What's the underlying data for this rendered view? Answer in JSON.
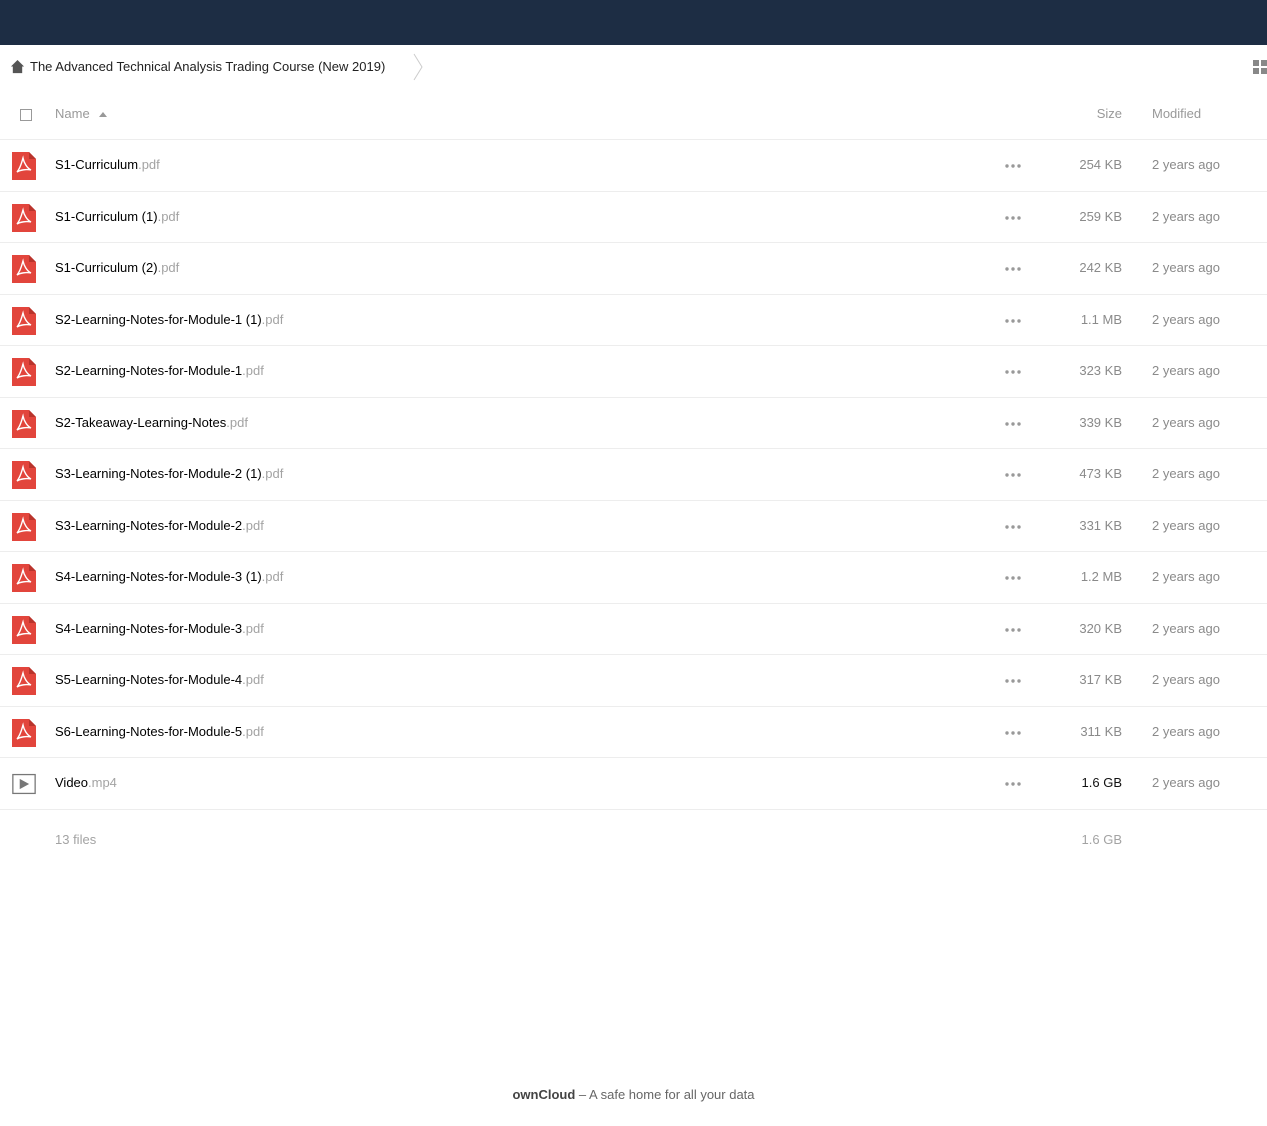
{
  "breadcrumb": {
    "folder": "The Advanced Technical Analysis Trading Course (New 2019)"
  },
  "table": {
    "headers": {
      "name": "Name",
      "size": "Size",
      "modified": "Modified"
    },
    "files": [
      {
        "base": "S1-Curriculum",
        "ext": ".pdf",
        "type": "pdf",
        "size": "254 KB",
        "modified": "2 years ago"
      },
      {
        "base": "S1-Curriculum (1)",
        "ext": ".pdf",
        "type": "pdf",
        "size": "259 KB",
        "modified": "2 years ago"
      },
      {
        "base": "S1-Curriculum (2)",
        "ext": ".pdf",
        "type": "pdf",
        "size": "242 KB",
        "modified": "2 years ago"
      },
      {
        "base": "S2-Learning-Notes-for-Module-1 (1)",
        "ext": ".pdf",
        "type": "pdf",
        "size": "1.1 MB",
        "modified": "2 years ago"
      },
      {
        "base": "S2-Learning-Notes-for-Module-1",
        "ext": ".pdf",
        "type": "pdf",
        "size": "323 KB",
        "modified": "2 years ago"
      },
      {
        "base": "S2-Takeaway-Learning-Notes",
        "ext": ".pdf",
        "type": "pdf",
        "size": "339 KB",
        "modified": "2 years ago"
      },
      {
        "base": "S3-Learning-Notes-for-Module-2 (1)",
        "ext": ".pdf",
        "type": "pdf",
        "size": "473 KB",
        "modified": "2 years ago"
      },
      {
        "base": "S3-Learning-Notes-for-Module-2",
        "ext": ".pdf",
        "type": "pdf",
        "size": "331 KB",
        "modified": "2 years ago"
      },
      {
        "base": "S4-Learning-Notes-for-Module-3 (1)",
        "ext": ".pdf",
        "type": "pdf",
        "size": "1.2 MB",
        "modified": "2 years ago"
      },
      {
        "base": "S4-Learning-Notes-for-Module-3",
        "ext": ".pdf",
        "type": "pdf",
        "size": "320 KB",
        "modified": "2 years ago"
      },
      {
        "base": "S5-Learning-Notes-for-Module-4",
        "ext": ".pdf",
        "type": "pdf",
        "size": "317 KB",
        "modified": "2 years ago"
      },
      {
        "base": "S6-Learning-Notes-for-Module-5",
        "ext": ".pdf",
        "type": "pdf",
        "size": "311 KB",
        "modified": "2 years ago"
      },
      {
        "base": "Video",
        "ext": ".mp4",
        "type": "video",
        "size": "1.6 GB",
        "modified": "2 years ago"
      }
    ]
  },
  "summary": {
    "files": "13 files",
    "size": "1.6 GB"
  },
  "footer": {
    "brand": "ownCloud",
    "tagline": " – A safe home for all your data"
  },
  "colors": {
    "topbar": "#1d2d44",
    "pdf_icon": "#e2453c"
  }
}
